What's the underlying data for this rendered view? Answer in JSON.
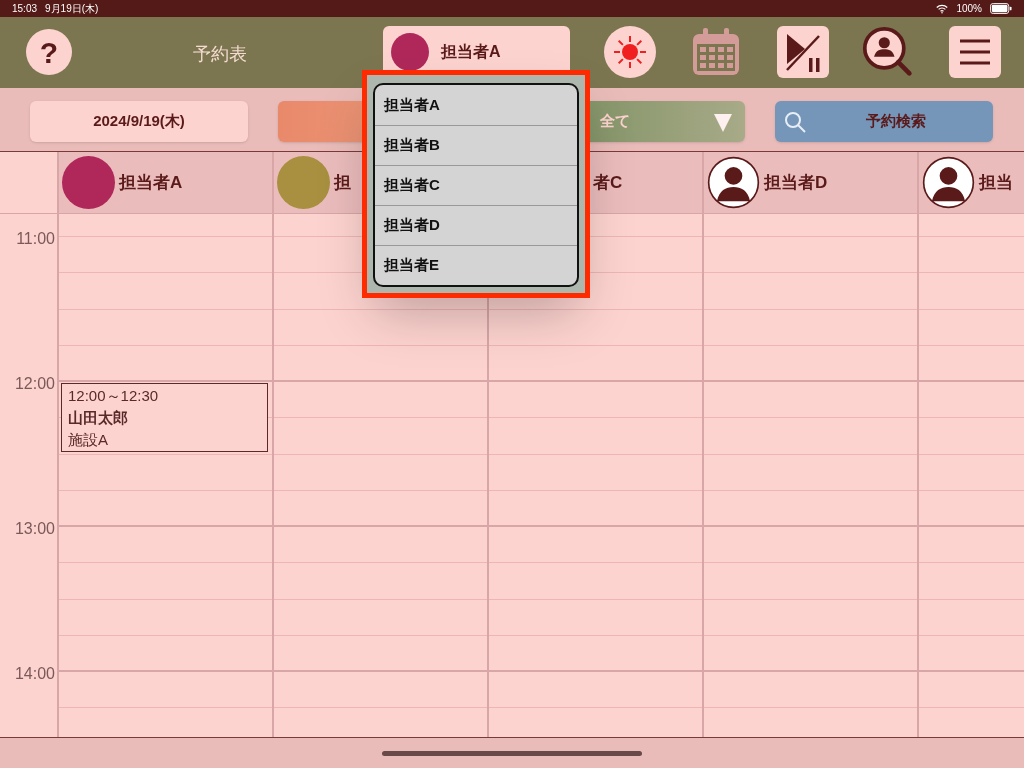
{
  "status_bar": {
    "time": "15:03",
    "date": "9月19日(木)",
    "battery": "100%"
  },
  "toolbar": {
    "help": "?",
    "title": "予約表",
    "staff_selector": {
      "label": "担当者A",
      "color": "#b0285a"
    },
    "icons": [
      {
        "kind": "sun"
      },
      {
        "kind": "calendar"
      },
      {
        "kind": "play-pause"
      },
      {
        "kind": "person-search"
      },
      {
        "kind": "menu"
      }
    ]
  },
  "filter_bar": {
    "date": "2024/9/19(木)",
    "filter": "全て",
    "search": "予約検索"
  },
  "columns": [
    {
      "name": "担当者A",
      "kind": "photo",
      "color": "#b0285a",
      "appointments": [
        {
          "time": "12:00～12:30",
          "name": "山田太郎",
          "place": "施設A"
        }
      ]
    },
    {
      "name": "担",
      "kind": "photo",
      "color": "#a89040"
    },
    {
      "name": "者C"
    },
    {
      "name": "担当者D",
      "kind": "silhouette"
    },
    {
      "name": "担当",
      "kind": "silhouette"
    }
  ],
  "time_labels": [
    "11:00",
    "12:00",
    "13:00",
    "14:00"
  ],
  "dropdown": {
    "items": [
      {
        "label": "担当者A"
      },
      {
        "label": "担当者B"
      },
      {
        "label": "担当者C"
      },
      {
        "label": "担当者D"
      },
      {
        "label": "担当者E"
      }
    ]
  }
}
